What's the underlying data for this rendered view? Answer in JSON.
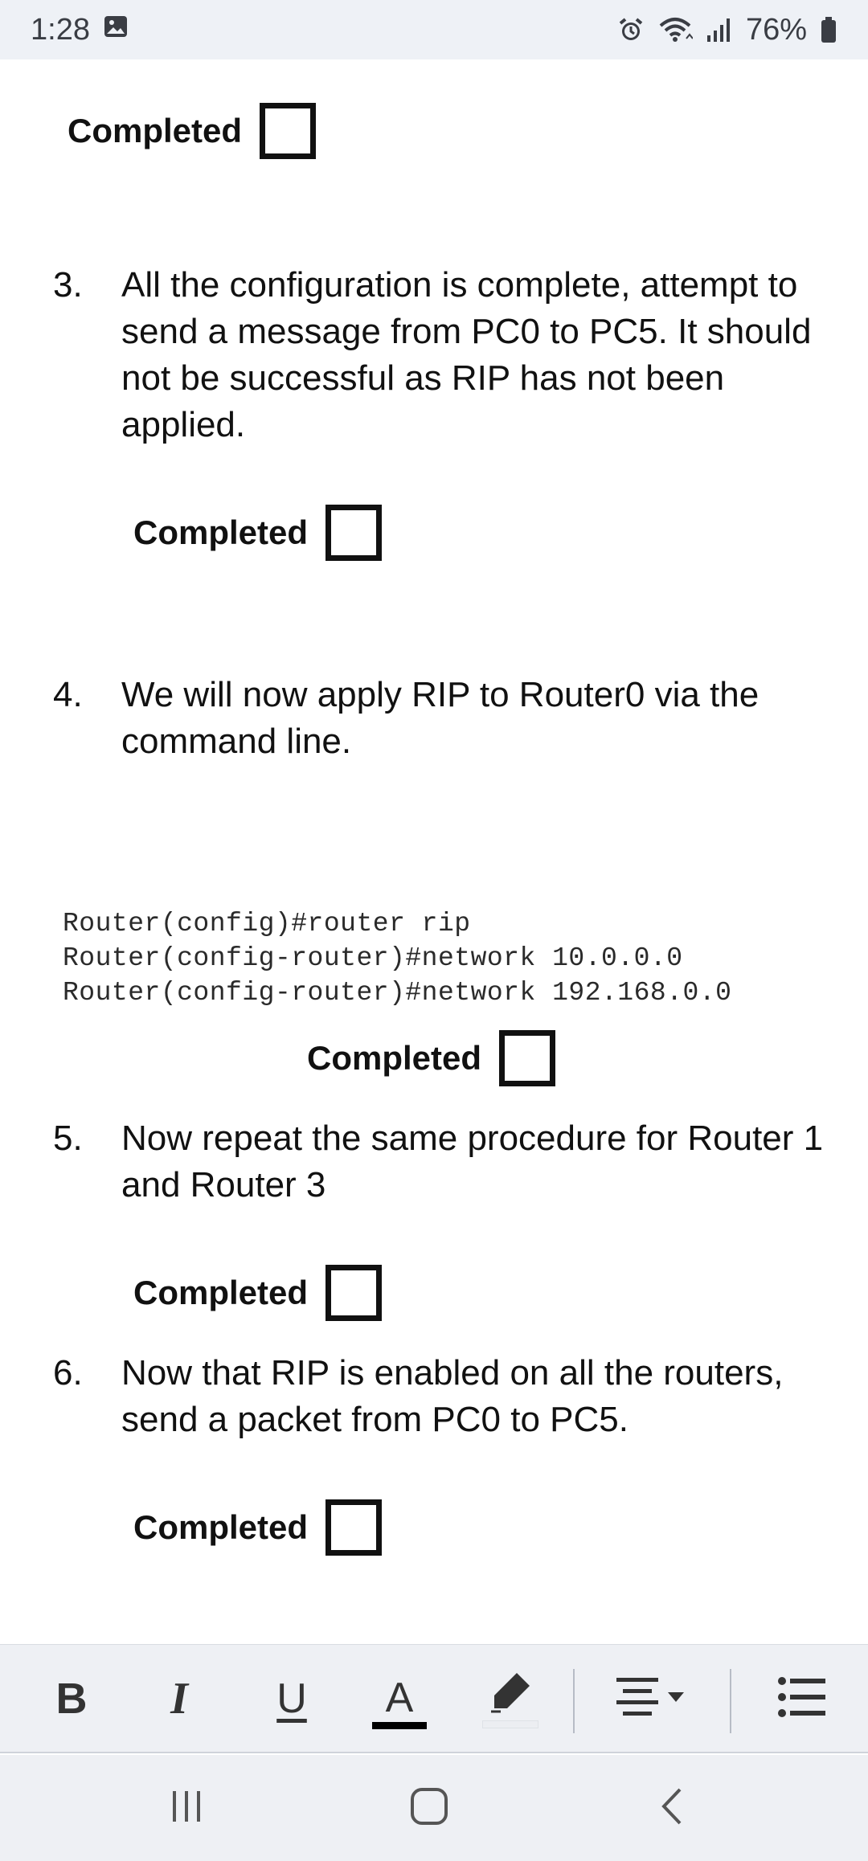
{
  "status_bar": {
    "time": "1:28",
    "battery_percent": "76%",
    "icons": [
      "image-icon",
      "alarm-icon",
      "wifi-icon",
      "signal-icon",
      "battery-icon"
    ]
  },
  "document": {
    "completed_label": "Completed",
    "items": [
      {
        "number": "3.",
        "text": "All the configuration is complete, attempt to send a message from PC0 to PC5. It should not be successful as RIP has not been applied."
      },
      {
        "number": "4.",
        "text": "We will now apply RIP to Router0 via the command line."
      },
      {
        "number": "5.",
        "text": "Now repeat the same procedure for Router 1 and Router 3"
      },
      {
        "number": "6.",
        "text": "Now that RIP is enabled on all the routers, send a packet from PC0 to PC5."
      }
    ],
    "code_lines": [
      "Router(config)#router rip",
      "Router(config-router)#network 10.0.0.0",
      "Router(config-router)#network 192.168.0.0"
    ]
  },
  "toolbar": {
    "bold_label": "B",
    "italic_label": "I",
    "underline_label": "U",
    "font_color_label": "A",
    "font_color": "#000000",
    "icons": [
      "bold-icon",
      "italic-icon",
      "underline-icon",
      "font-color-icon",
      "highlighter-icon",
      "align-icon",
      "list-icon"
    ]
  },
  "navbar": {
    "icons": [
      "recent-apps-icon",
      "home-icon",
      "back-icon"
    ]
  }
}
